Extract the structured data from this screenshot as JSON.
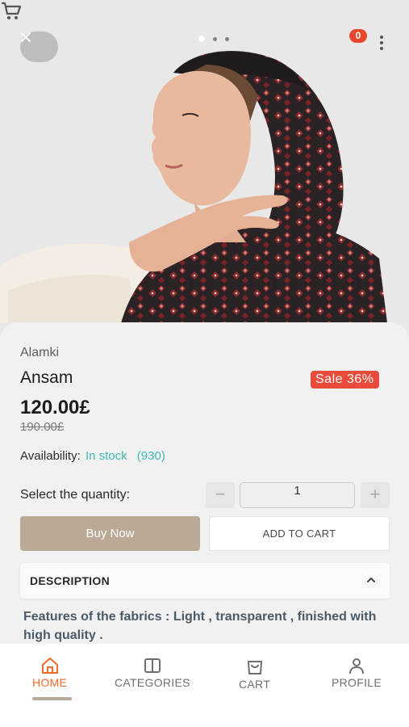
{
  "header": {
    "cart_count": "0",
    "close_icon": "close-icon",
    "cart_icon": "cart-icon",
    "menu_icon": "more-vertical-icon"
  },
  "product": {
    "brand": "Alamki",
    "name": "Ansam",
    "sale_badge": "Sale 36%",
    "price": "120.00£",
    "old_price": "190.00£",
    "availability_label": "Availability:",
    "availability_status": "In stock",
    "availability_count": "(930)"
  },
  "quantity": {
    "label": "Select the quantity:",
    "minus": "−",
    "value": "1",
    "plus": "+"
  },
  "actions": {
    "buy_now": "Buy Now",
    "add_to_cart": "ADD TO CART"
  },
  "description": {
    "title": "DESCRIPTION",
    "text": "Features of the fabrics : Light , transparent , finished with high quality ."
  },
  "nav": {
    "items": [
      {
        "label": "HOME",
        "icon": "home-icon",
        "active": true
      },
      {
        "label": "CATEGORIES",
        "icon": "categories-icon",
        "active": false
      },
      {
        "label": "CART",
        "icon": "cart-icon",
        "active": false
      },
      {
        "label": "PROFILE",
        "icon": "profile-icon",
        "active": false
      }
    ]
  },
  "colors": {
    "accent": "#f06a2a",
    "sale": "#ea4a3a",
    "stock": "#3fb9b2",
    "buy_now": "#baa995"
  }
}
